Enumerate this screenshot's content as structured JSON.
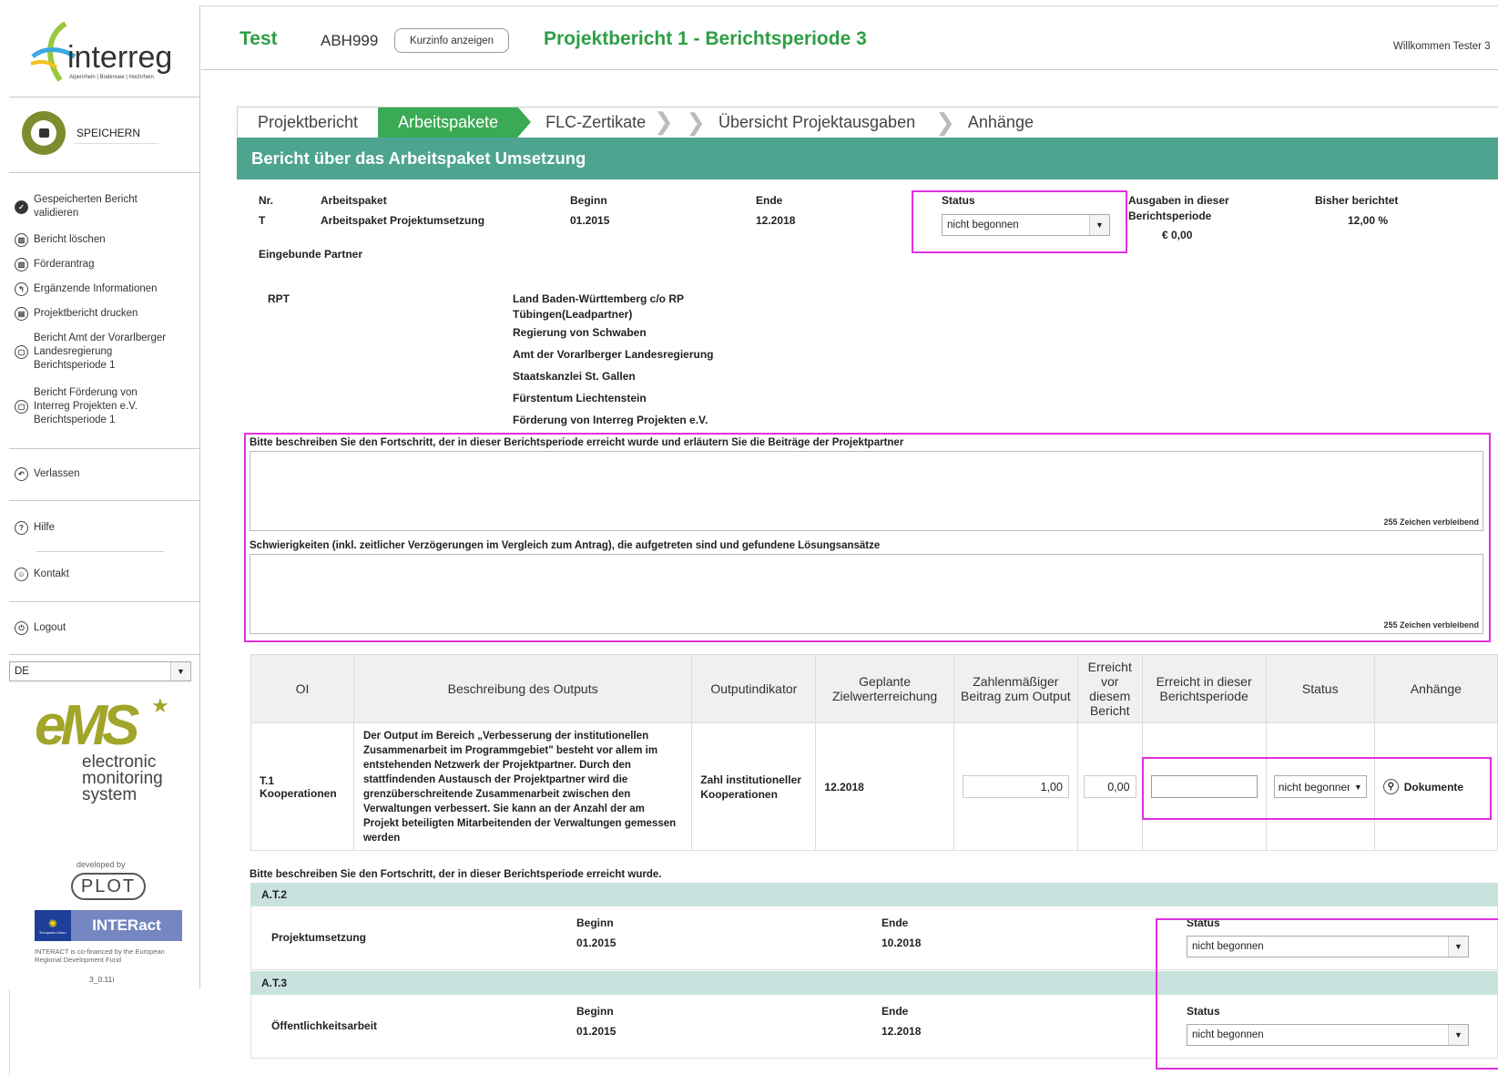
{
  "app": {
    "logo_text": "interreg",
    "logo_subtitle": "Alpenrhein | Bodensee | Hochrhein",
    "colors": {
      "green": "#3aaa55",
      "teal": "#4da48f",
      "title_green": "#2e9e46",
      "highlight": "#e030e0"
    }
  },
  "header": {
    "project_name": "Test",
    "project_code": "ABH999",
    "kurzinfo_label": "Kurzinfo anzeigen",
    "report_title": "Projektbericht 1 - Berichtsperiode 3",
    "welcome": "Willkommen Tester 3"
  },
  "sidebar": {
    "save_label": "SPEICHERN",
    "items": [
      {
        "label": "Gespeicherten Bericht validieren",
        "icon": "check-icon"
      },
      {
        "label": "Bericht löschen",
        "icon": "trash-icon"
      },
      {
        "label": "Förderantrag",
        "icon": "bank-icon"
      },
      {
        "label": "Ergänzende Informationen",
        "icon": "info-icon"
      },
      {
        "label": "Projektbericht drucken",
        "icon": "print-icon"
      },
      {
        "label": "Bericht Amt der Vorarlberger Landesregierung Berichtsperiode 1",
        "icon": "document-icon"
      },
      {
        "label": "Bericht Förderung von Interreg Projekten e.V. Berichtsperiode 1",
        "icon": "document-icon"
      }
    ],
    "leave_label": "Verlassen",
    "help_label": "Hilfe",
    "contact_label": "Kontakt",
    "logout_label": "Logout",
    "language": "DE",
    "ems_logo": "eMS",
    "ems_line1": "electronic",
    "ems_line2": "monitoring",
    "ems_line3": "system",
    "developed_by": "developed by",
    "plot_logo": "PLOT",
    "interact_logo": "INTERact",
    "eu_caption": "European Union",
    "cofinanced": "INTERACT is co-financed by the European Regional Development Fund",
    "version": "3_0.11i"
  },
  "tabs": [
    {
      "label": "Projektbericht"
    },
    {
      "label": "Arbeitspakete"
    },
    {
      "label": "FLC-Zertikate"
    },
    {
      "label": "Übersicht Projektausgaben"
    },
    {
      "label": "Anhänge"
    }
  ],
  "section_title": "Bericht über das Arbeitspaket Umsetzung",
  "workpackage": {
    "nr_label": "Nr.",
    "nr_value": "T",
    "ap_label": "Arbeitspaket",
    "ap_value": "Arbeitspaket Projektumsetzung",
    "begin_label": "Beginn",
    "begin_value": "01.2015",
    "end_label": "Ende",
    "end_value": "12.2018",
    "status_label": "Status",
    "status_value": "nicht begonnen",
    "expenses_label_1": "Ausgaben in dieser",
    "expenses_label_2": "Berichtsperiode",
    "expenses_value": "€ 0,00",
    "reported_label": "Bisher berichtet",
    "reported_value": "12,00 %",
    "partners_label": "Eingebunde Partner",
    "partner_code": "RPT",
    "partners": [
      "Land Baden-Württemberg c/o RP Tübingen(Leadpartner)",
      "Regierung von Schwaben",
      "Amt der Vorarlberger Landesregierung",
      "Staatskanzlei St. Gallen",
      "Fürstentum Liechtenstein",
      "Förderung von Interreg Projekten e.V."
    ]
  },
  "progress": {
    "label": "Bitte beschreiben Sie den Fortschritt, der in dieser Berichtsperiode erreicht wurde und erläutern Sie die Beiträge der Projektpartner",
    "counter": "255 Zeichen verbleibend"
  },
  "difficulties": {
    "label": "Schwierigkeiten (inkl. zeitlicher Verzögerungen im Vergleich zum Antrag), die aufgetreten sind und gefundene Lösungsansätze",
    "counter": "255 Zeichen verbleibend"
  },
  "output_table": {
    "headers": [
      "OI",
      "Beschreibung des Outputs",
      "Outputindikator",
      "Geplante Zielwerterreichung",
      "Zahlenmäßiger Beitrag zum Output",
      "Erreicht vor diesem Bericht",
      "Erreicht in dieser Berichtsperiode",
      "Status",
      "Anhänge"
    ],
    "row": {
      "oi": "T.1 Kooperationen",
      "description": "Der Output im Bereich „Verbesserung der institutionellen Zusammenarbeit im Programmgebiet\" besteht vor allem im entstehenden Netzwerk der Projektpartner. Durch den stattfindenden Austausch der Projektpartner wird die grenzüberschreitende Zusammenarbeit zwischen den Verwaltungen verbessert. Sie kann an der Anzahl der am Projekt beteiligten Mitarbeitenden der Verwaltungen gemessen werden",
      "indicator": "Zahl institutioneller Kooperationen",
      "planned": "12.2018",
      "contribution": "1,00",
      "achieved_before": "0,00",
      "achieved_now": "",
      "status": "nicht begonnen",
      "attachments_label": "Dokumente"
    }
  },
  "activities": {
    "intro": "Bitte beschreiben Sie den Fortschritt, der in dieser Berichtsperiode erreicht wurde.",
    "items": [
      {
        "code": "A.T.2",
        "name": "Projektumsetzung",
        "begin_label": "Beginn",
        "begin": "01.2015",
        "end_label": "Ende",
        "end": "10.2018",
        "status_label": "Status",
        "status": "nicht begonnen"
      },
      {
        "code": "A.T.3",
        "name": "Öffentlichkeitsarbeit",
        "begin_label": "Beginn",
        "begin": "01.2015",
        "end_label": "Ende",
        "end": "12.2018",
        "status_label": "Status",
        "status": "nicht begonnen"
      }
    ]
  }
}
